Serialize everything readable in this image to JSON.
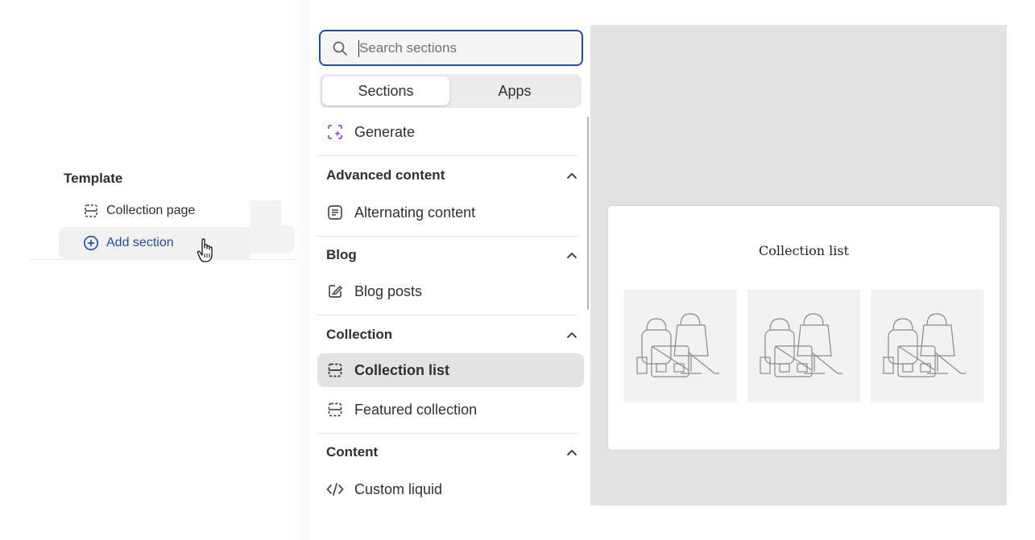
{
  "template": {
    "title": "Template",
    "items": [
      {
        "label": "Collection page",
        "icon": "section-layout-icon"
      },
      {
        "label": "Add section",
        "icon": "plus-circle-icon"
      }
    ]
  },
  "picker": {
    "search": {
      "placeholder": "Search sections",
      "value": ""
    },
    "tabs": [
      "Sections",
      "Apps"
    ],
    "generate_label": "Generate",
    "groups": [
      {
        "heading": "Advanced content",
        "items": [
          "Alternating content"
        ]
      },
      {
        "heading": "Blog",
        "items": [
          "Blog posts"
        ]
      },
      {
        "heading": "Collection",
        "items": [
          "Collection list",
          "Featured collection"
        ]
      },
      {
        "heading": "Content",
        "items": [
          "Custom liquid"
        ]
      }
    ]
  },
  "preview": {
    "title": "Collection list"
  },
  "colors": {
    "accent_blue": "#1f4e9c",
    "generate_purple": "#8a4cf4",
    "preview_bg": "#e3e3e3",
    "selected_bg": "#e3e3e3"
  }
}
